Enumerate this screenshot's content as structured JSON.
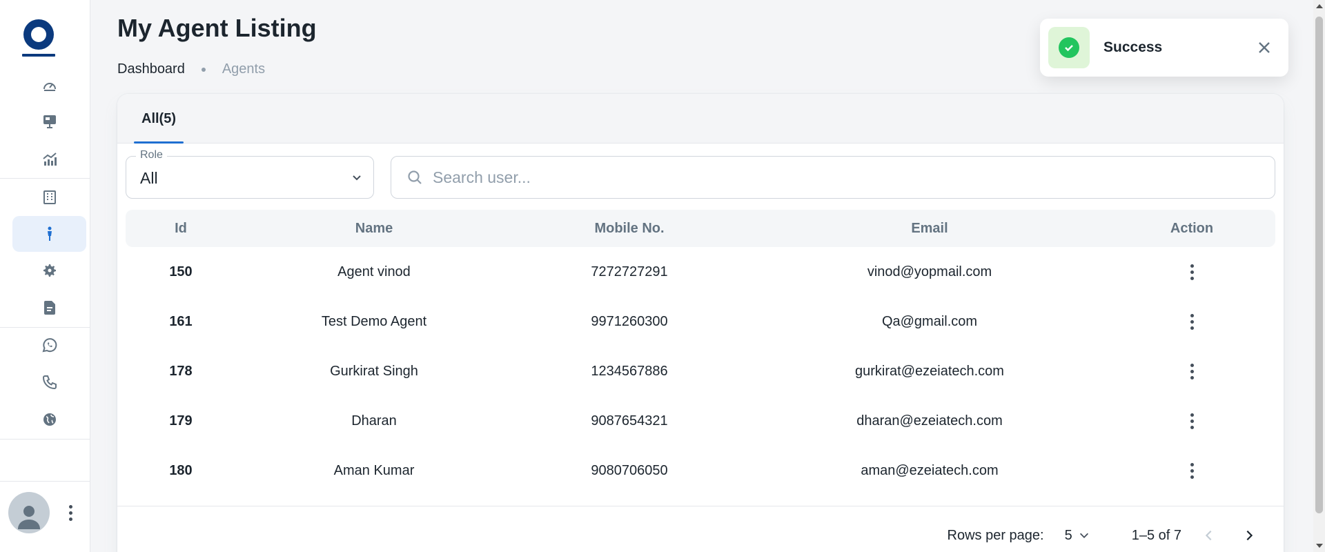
{
  "page": {
    "title": "My Agent Listing"
  },
  "breadcrumb": {
    "items": [
      "Dashboard",
      "Agents"
    ]
  },
  "toast": {
    "message": "Success",
    "status_color": "#22c55e"
  },
  "sidebar": {
    "items": [
      {
        "icon": "dashboard-gauge-icon"
      },
      {
        "icon": "presentation-icon"
      },
      {
        "icon": "analytics-chart-icon"
      },
      {
        "icon": "building-icon"
      },
      {
        "icon": "agent-person-icon",
        "active": true
      },
      {
        "icon": "gear-icon"
      },
      {
        "icon": "document-icon"
      },
      {
        "icon": "whatsapp-icon"
      },
      {
        "icon": "phone-icon"
      },
      {
        "icon": "globe-icon"
      }
    ],
    "accent": "#1f6fd1"
  },
  "tabs": [
    {
      "label": "All(5)",
      "active": true
    }
  ],
  "filters": {
    "role": {
      "label": "Role",
      "value": "All"
    },
    "search": {
      "placeholder": "Search user..."
    }
  },
  "table": {
    "columns": [
      "Id",
      "Name",
      "Mobile No.",
      "Email",
      "Action"
    ],
    "rows": [
      {
        "id": "150",
        "name": "Agent vinod",
        "mobile": "7272727291",
        "email": "vinod@yopmail.com"
      },
      {
        "id": "161",
        "name": "Test Demo Agent",
        "mobile": "9971260300",
        "email": "Qa@gmail.com"
      },
      {
        "id": "178",
        "name": "Gurkirat Singh",
        "mobile": "1234567886",
        "email": "gurkirat@ezeiatech.com"
      },
      {
        "id": "179",
        "name": "Dharan",
        "mobile": "9087654321",
        "email": "dharan@ezeiatech.com"
      },
      {
        "id": "180",
        "name": "Aman Kumar",
        "mobile": "9080706050",
        "email": "aman@ezeiatech.com"
      }
    ]
  },
  "pagination": {
    "rows_per_page_label": "Rows per page:",
    "rows_per_page": "5",
    "range": "1–5 of 7"
  }
}
